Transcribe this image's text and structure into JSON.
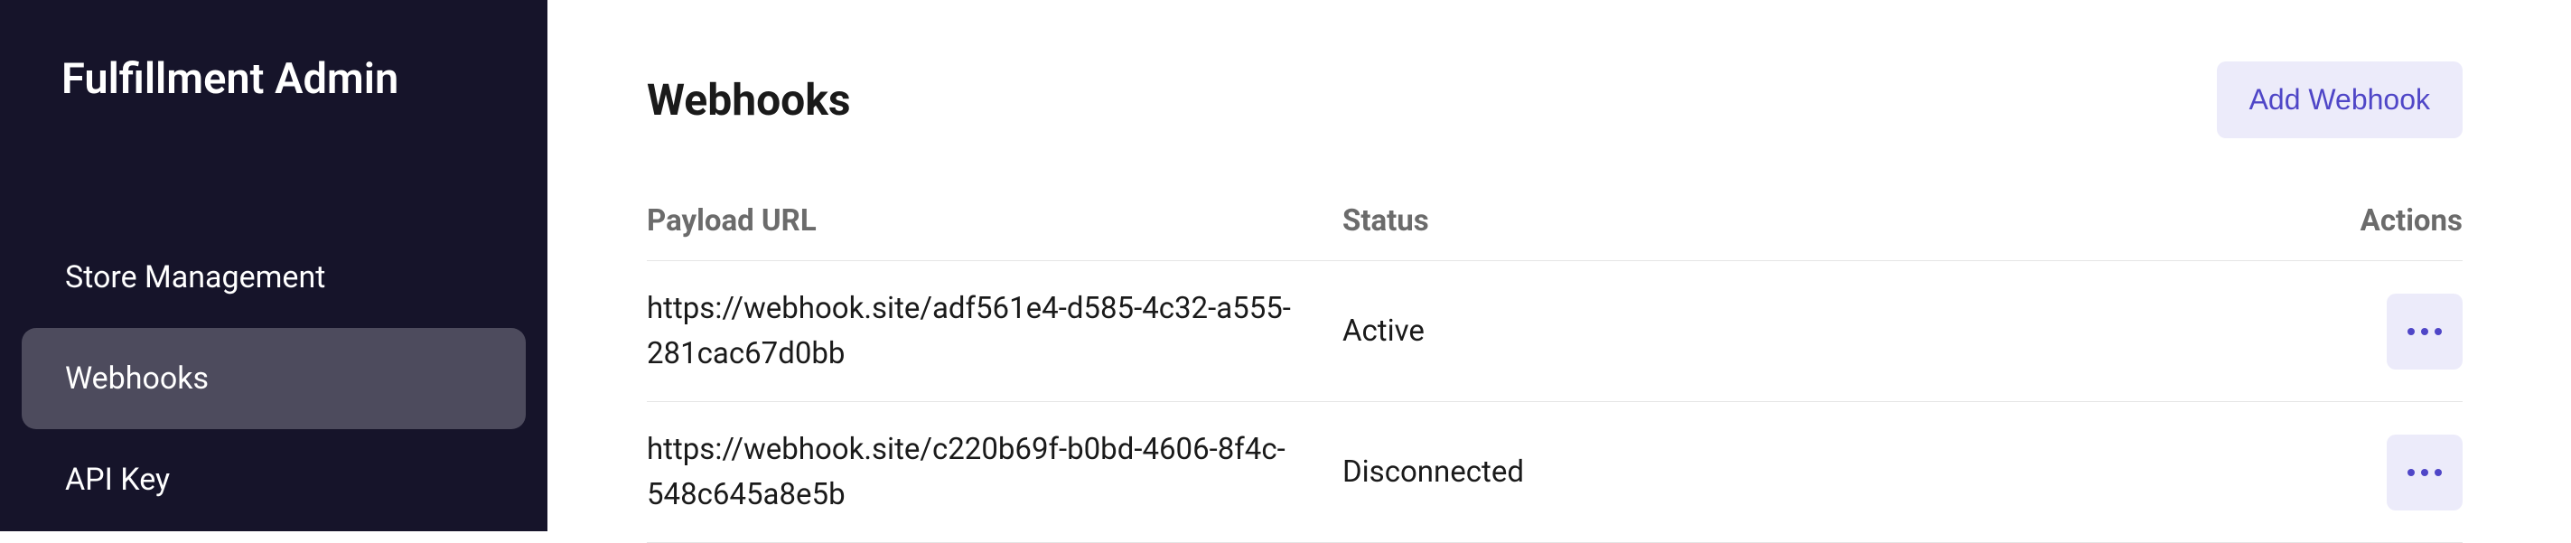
{
  "sidebar": {
    "title": "Fulfillment Admin",
    "items": [
      {
        "label": "Store Management",
        "active": false
      },
      {
        "label": "Webhooks",
        "active": true
      },
      {
        "label": "API Key",
        "active": false
      }
    ]
  },
  "main": {
    "title": "Webhooks",
    "add_button_label": "Add Webhook",
    "columns": {
      "url": "Payload URL",
      "status": "Status",
      "actions": "Actions"
    },
    "rows": [
      {
        "url": "https://webhook.site/adf561e4-d585-4c32-a555-281cac67d0bb",
        "status": "Active"
      },
      {
        "url": "https://webhook.site/c220b69f-b0bd-4606-8f4c-548c645a8e5b",
        "status": "Disconnected"
      }
    ]
  }
}
